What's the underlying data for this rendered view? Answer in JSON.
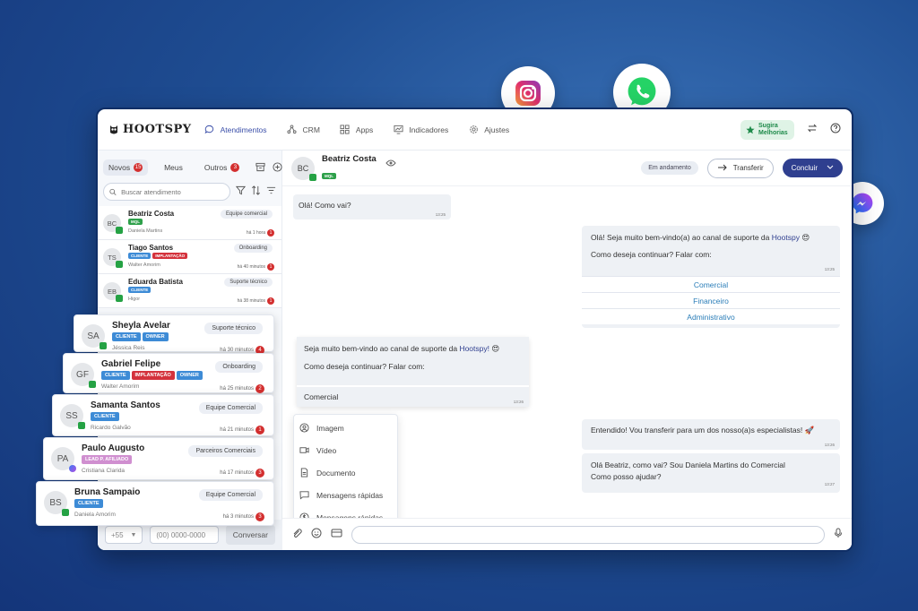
{
  "brand": {
    "name": "HOOTSPY"
  },
  "nav": [
    {
      "label": "Atendimentos"
    },
    {
      "label": "CRM"
    },
    {
      "label": "Apps"
    },
    {
      "label": "Indicadores"
    },
    {
      "label": "Ajustes"
    }
  ],
  "topright": {
    "suggest_label": "Sugira Melhorias"
  },
  "tabs": {
    "novos_label": "Novos",
    "novos_count": "15",
    "meus_label": "Meus",
    "outros_label": "Outros",
    "outros_count": "3"
  },
  "search": {
    "placeholder": "Buscar atendimento"
  },
  "contacts": [
    {
      "initials": "BC",
      "name": "Beatriz Costa",
      "tags": [
        "MQL"
      ],
      "agent": "Daniela Martins",
      "dept": "Equipe comercial",
      "time": "há 1 hora",
      "count": "1",
      "channel": "whatsapp"
    },
    {
      "initials": "TS",
      "name": "Tiago Santos",
      "tags": [
        "CLIENTE",
        "IMPLANTAÇÃO"
      ],
      "agent": "Walter Amorim",
      "dept": "Onboarding",
      "time": "há 40 minutos",
      "count": "1",
      "channel": "whatsapp"
    },
    {
      "initials": "EB",
      "name": "Eduarda Batista",
      "tags": [
        "CLIENTE"
      ],
      "agent": "Higor",
      "dept": "Suporte técnico",
      "time": "há 38 minutos",
      "count": "1",
      "channel": "whatsapp"
    }
  ],
  "cards": [
    {
      "initials": "SA",
      "name": "Sheyla Avelar",
      "tags": [
        "CLIENTE",
        "OWNER"
      ],
      "agent": "Jéssica Reis",
      "dept": "Suporte técnico",
      "time": "há 30 minutos",
      "count": "4",
      "channel": "whatsapp"
    },
    {
      "initials": "GF",
      "name": "Gabriel Felipe",
      "tags": [
        "CLIENTE",
        "IMPLANTAÇÃO",
        "OWNER"
      ],
      "agent": "Walter Amorim",
      "dept": "Onboarding",
      "time": "há 25 minutos",
      "count": "2",
      "channel": "whatsapp"
    },
    {
      "initials": "SS",
      "name": "Samanta Santos",
      "tags": [
        "CLIENTE"
      ],
      "agent": "Ricardo Galvão",
      "dept": "Equipe Comercial",
      "time": "há 21 minutos",
      "count": "1",
      "channel": "whatsapp"
    },
    {
      "initials": "PA",
      "name": "Paulo Augusto",
      "tags": [
        "LEAD P. AFILIADO"
      ],
      "agent": "Cristiana Clarida",
      "dept": "Parceiros Comerciais",
      "time": "há 17 minutos",
      "count": "3",
      "channel": "messenger"
    },
    {
      "initials": "BS",
      "name": "Bruna Sampaio",
      "tags": [
        "CLIENTE"
      ],
      "agent": "Daniela Amorim",
      "dept": "Equipe Comercial",
      "time": "há 3 minutos",
      "count": "3",
      "channel": "whatsapp"
    }
  ],
  "phonebar": {
    "ddi": "+55",
    "phone_placeholder": "(00) 0000-0000",
    "button": "Conversar"
  },
  "chat": {
    "initials": "BC",
    "name": "Beatriz Costa",
    "tag": "MQL",
    "status": "Em andamento",
    "transfer_label": "Transferir",
    "conclude_label": "Concluir",
    "messages": {
      "m1": {
        "text": "Olá! Como vai?",
        "time": "13:25"
      },
      "m2": {
        "line1": "Olá! Seja muito bem-vindo(a) ao canal de suporte da",
        "brand": "Hootspy",
        "line2": "Como deseja continuar? Falar com:",
        "time": "13:25",
        "options": [
          "Comercial",
          "Financeiro",
          "Administrativo"
        ]
      },
      "m3": {
        "line1": "Seja muito bem-vindo ao canal de suporte da",
        "brand": "Hootspy!",
        "line2": "Como deseja continuar? Falar com:",
        "reply": "Comercial",
        "time": "13:26"
      },
      "m4": {
        "text": "Entendido! Vou transferir para um dos nosso(a)s especialistas! 🚀",
        "time": "13:26"
      },
      "m5": {
        "line1": "Olá Beatriz, como vai? Sou Daniela Martins do Comercial",
        "line2": "Como posso ajudar?",
        "time": "13:27"
      }
    },
    "attach_menu": [
      "Imagem",
      "Vídeo",
      "Documento",
      "Mensagens rápidas",
      "Mensagens rápidas"
    ]
  },
  "colors": {
    "accent": "#2f3f8f",
    "whatsapp": "#25a244",
    "badge": "#d32f2f"
  }
}
